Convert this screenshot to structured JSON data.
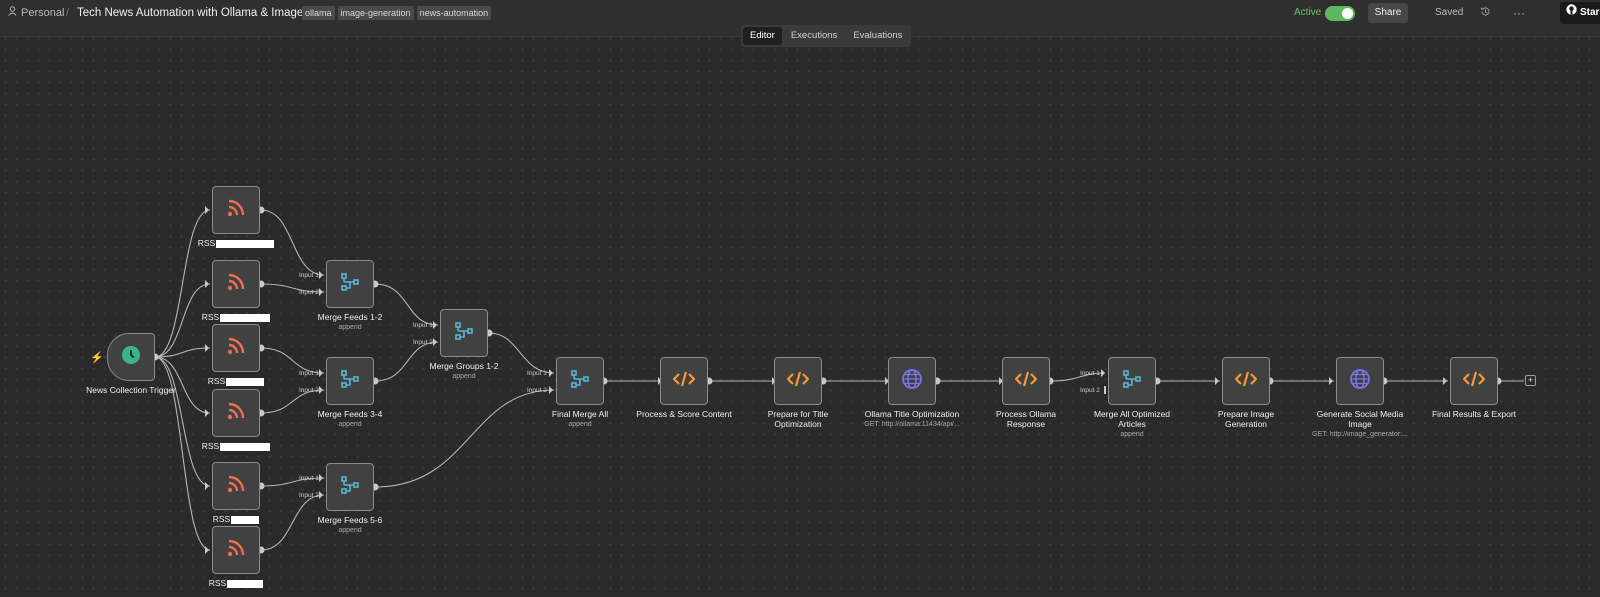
{
  "header": {
    "breadcrumb_home": "Personal",
    "separator": "/",
    "title": "Tech News Automation with Ollama & Images",
    "tags": [
      "ollama",
      "image-generation",
      "news-automation"
    ],
    "active_label": "Active",
    "active": true,
    "share_label": "Share",
    "saved_label": "Saved",
    "star_label": "Star",
    "more_label": "···"
  },
  "tabs": [
    {
      "label": "Editor",
      "active": true
    },
    {
      "label": "Executions",
      "active": false
    },
    {
      "label": "Evaluations",
      "active": false
    }
  ],
  "colors": {
    "rss": "#f26b4e",
    "merge": "#55b8d6",
    "code": "#f59b2f",
    "http": "#7b74e8",
    "trigger": "#3cb489",
    "active_toggle": "#5cb85c"
  },
  "nodes": [
    {
      "id": "trigger",
      "type": "trigger",
      "icon": "clock-icon",
      "label": "News Collection Trigger",
      "sub": ""
    },
    {
      "id": "rss1",
      "type": "rss",
      "icon": "rss-icon",
      "label": "RSS",
      "sub": ""
    },
    {
      "id": "rss2",
      "type": "rss",
      "icon": "rss-icon",
      "label": "RSS",
      "sub": ""
    },
    {
      "id": "rss3",
      "type": "rss",
      "icon": "rss-icon",
      "label": "RSS",
      "sub": ""
    },
    {
      "id": "rss4",
      "type": "rss",
      "icon": "rss-icon",
      "label": "RSS",
      "sub": ""
    },
    {
      "id": "rss5",
      "type": "rss",
      "icon": "rss-icon",
      "label": "RSS",
      "sub": ""
    },
    {
      "id": "rss6",
      "type": "rss",
      "icon": "rss-icon",
      "label": "RSS",
      "sub": ""
    },
    {
      "id": "m12",
      "type": "merge",
      "icon": "merge-icon",
      "label": "Merge Feeds 1-2",
      "sub": "append"
    },
    {
      "id": "m34",
      "type": "merge",
      "icon": "merge-icon",
      "label": "Merge Feeds 3-4",
      "sub": "append"
    },
    {
      "id": "m56",
      "type": "merge",
      "icon": "merge-icon",
      "label": "Merge Feeds 5-6",
      "sub": "append"
    },
    {
      "id": "mg12",
      "type": "merge",
      "icon": "merge-icon",
      "label": "Merge Groups 1-2",
      "sub": "append"
    },
    {
      "id": "final",
      "type": "merge",
      "icon": "merge-icon",
      "label": "Final Merge All",
      "sub": "append"
    },
    {
      "id": "score",
      "type": "code",
      "icon": "code-icon",
      "label": "Process & Score Content",
      "sub": ""
    },
    {
      "id": "prep_title",
      "type": "code",
      "icon": "code-icon",
      "label": "Prepare for Title Optimization",
      "sub": ""
    },
    {
      "id": "ollama",
      "type": "http",
      "icon": "globe-icon",
      "label": "Ollama Title Optimization",
      "sub": "GET: http://ollama:11434/api/..."
    },
    {
      "id": "proc_ollama",
      "type": "code",
      "icon": "code-icon",
      "label": "Process Ollama Response",
      "sub": ""
    },
    {
      "id": "merge_opt",
      "type": "merge",
      "icon": "merge-icon",
      "label": "Merge All Optimized Articles",
      "sub": "append"
    },
    {
      "id": "prep_img",
      "type": "code",
      "icon": "code-icon",
      "label": "Prepare Image Generation",
      "sub": ""
    },
    {
      "id": "gen_img",
      "type": "http",
      "icon": "globe-icon",
      "label": "Generate Social Media Image",
      "sub": "GET: http://image_generator:..."
    },
    {
      "id": "export",
      "type": "code",
      "icon": "code-icon",
      "label": "Final Results & Export",
      "sub": ""
    }
  ],
  "input_labels": {
    "input1": "Input 1",
    "input2": "Input 2"
  }
}
